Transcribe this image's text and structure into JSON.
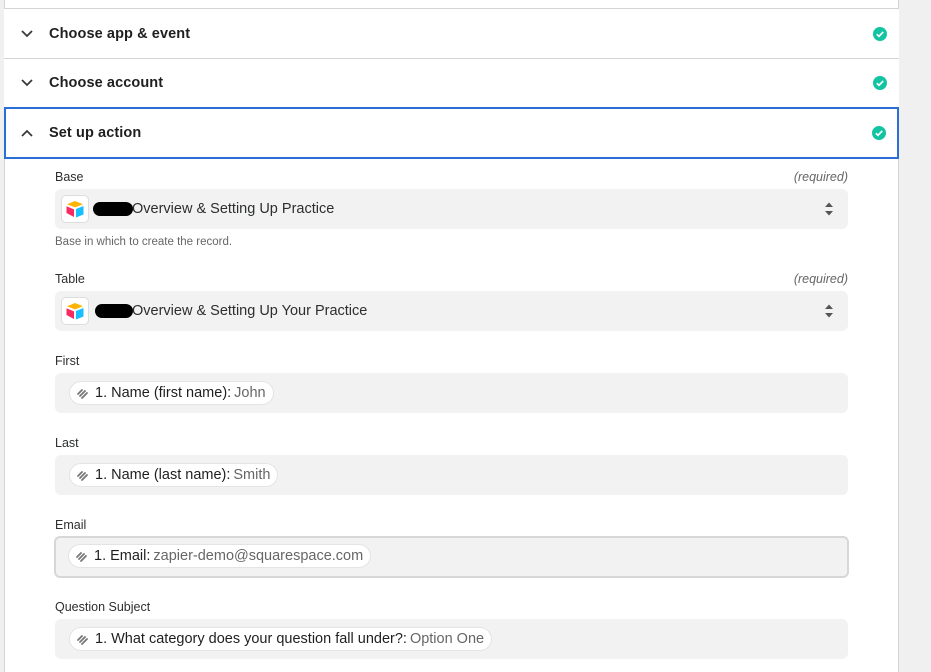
{
  "steps": [
    {
      "title": "Choose app & event",
      "state": "collapsed",
      "complete": true
    },
    {
      "title": "Choose account",
      "state": "collapsed",
      "complete": true
    },
    {
      "title": "Set up action",
      "state": "expanded",
      "complete": true
    }
  ],
  "fields": {
    "base": {
      "label": "Base",
      "required": "(required)",
      "value": "Overview & Setting Up Practice",
      "help": "Base in which to create the record."
    },
    "table": {
      "label": "Table",
      "required": "(required)",
      "value": "Overview & Setting Up Your Practice"
    },
    "first": {
      "label": "First",
      "pill_key": "1. Name (first name):",
      "pill_val": "John"
    },
    "last": {
      "label": "Last",
      "pill_key": "1. Name (last name):",
      "pill_val": "Smith"
    },
    "email": {
      "label": "Email",
      "pill_key": "1. Email:",
      "pill_val": "zapier-demo@squarespace.com"
    },
    "question_subject": {
      "label": "Question Subject",
      "pill_key": "1. What category does your question fall under?:",
      "pill_val": "Option One"
    }
  },
  "colors": {
    "check": "#13c4a3",
    "focus": "#2a6fd6",
    "field_bg": "#f2f2f2"
  }
}
